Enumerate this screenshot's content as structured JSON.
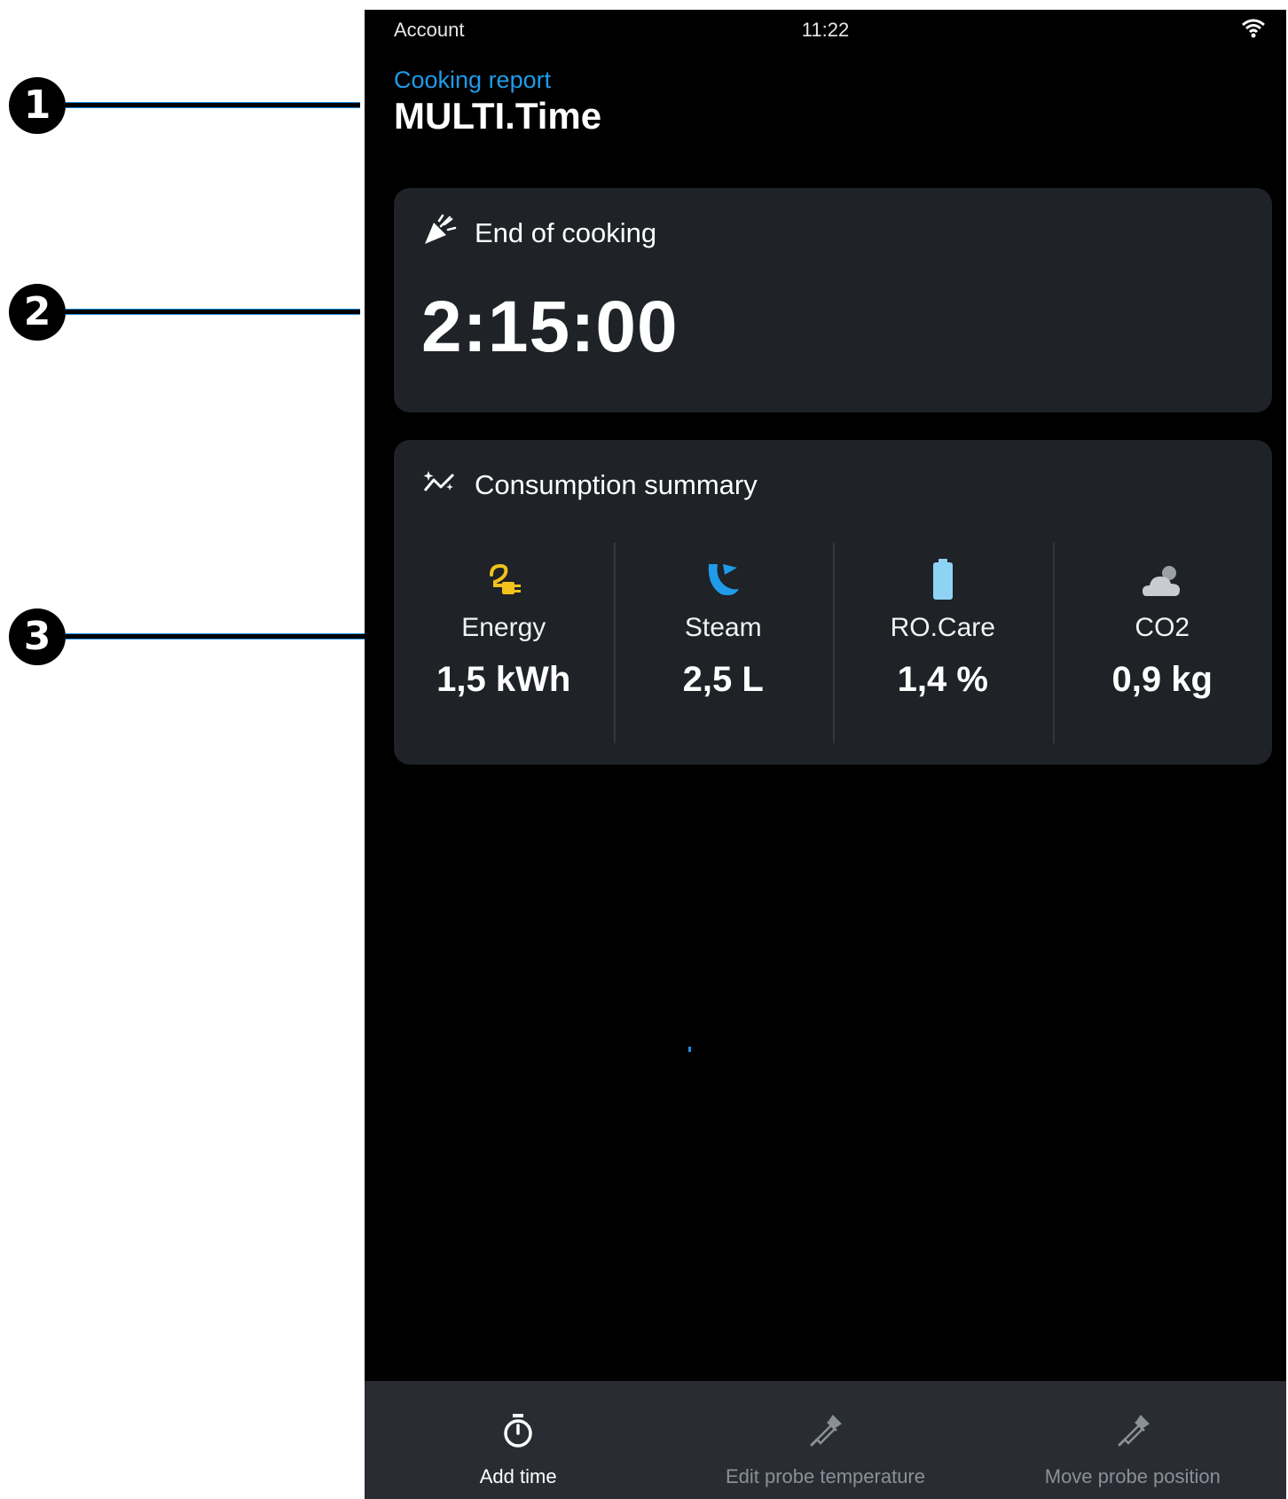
{
  "callouts": [
    "1",
    "2",
    "3"
  ],
  "status_bar": {
    "left_label": "Account",
    "time": "11:22",
    "icon": "wifi-icon"
  },
  "header": {
    "subtitle": "Cooking report",
    "title": "MULTI.Time"
  },
  "end_card": {
    "icon": "party-popper-icon",
    "title": "End of cooking",
    "time": "2:15:00"
  },
  "consumption_card": {
    "icon": "sparkle-chart-icon",
    "title": "Consumption summary",
    "metrics": [
      {
        "label": "Energy",
        "value": "1,5 kWh",
        "icon": "power-plug-icon",
        "color": "#f2c21b"
      },
      {
        "label": "Steam",
        "value": "2,5 L",
        "icon": "steam-icon",
        "color": "#1f9be9"
      },
      {
        "label": "RO.Care",
        "value": "1,4 %",
        "icon": "battery-icon",
        "color": "#8fd3f4"
      },
      {
        "label": "CO2",
        "value": "0,9 kg",
        "icon": "cloud-icon",
        "color": "#c8cbd0"
      }
    ]
  },
  "bottom_actions": [
    {
      "label": "Add time",
      "icon": "stopwatch-icon",
      "enabled": true
    },
    {
      "label": "Edit probe temperature",
      "icon": "probe-icon",
      "enabled": false
    },
    {
      "label": "Move probe position",
      "icon": "probe-icon",
      "enabled": false
    }
  ],
  "colors": {
    "accent": "#1f9be9",
    "card_bg": "#1f2226",
    "screen_bg": "#000000",
    "bottom_bar_bg": "#292d33"
  }
}
